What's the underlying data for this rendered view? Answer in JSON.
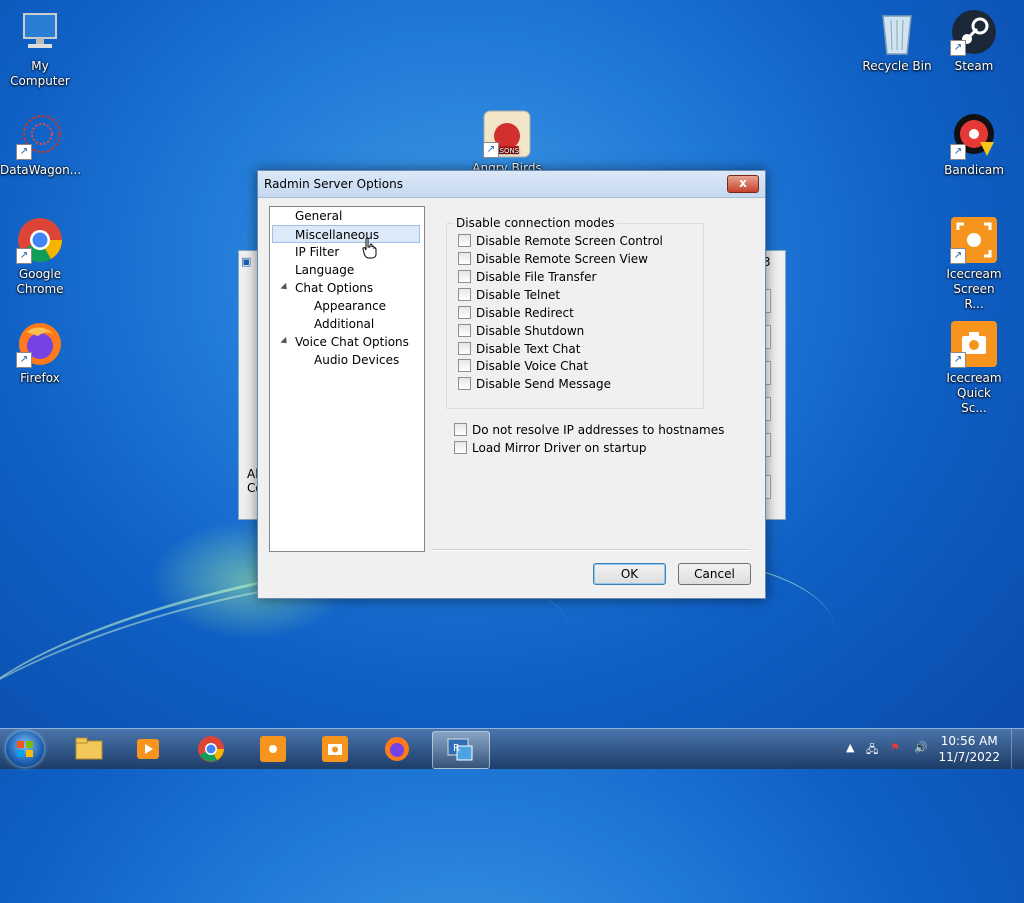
{
  "desktop_icons": {
    "my_computer": "My Computer",
    "datawagon": "DataWagon...",
    "chrome": "Google Chrome",
    "firefox": "Firefox",
    "angry_birds": "Angry Birds",
    "recycle_bin": "Recycle Bin",
    "steam": "Steam",
    "bandicam": "Bandicam",
    "icecream_rec": "Icecream Screen R...",
    "icecream_quick": "Icecream Quick Sc..."
  },
  "background_window": {
    "frag1": "All",
    "frag2": "Co",
    "frag3": "3"
  },
  "dialog": {
    "title": "Radmin Server Options",
    "close_label": "x",
    "tree": {
      "general": "General",
      "misc": "Miscellaneous",
      "ipfilter": "IP Filter",
      "language": "Language",
      "chat": "Chat Options",
      "appearance": "Appearance",
      "additional": "Additional",
      "voice": "Voice Chat Options",
      "audio": "Audio Devices"
    },
    "group_title": "Disable connection modes",
    "checkboxes": [
      "Disable Remote Screen Control",
      "Disable Remote Screen View",
      "Disable File Transfer",
      "Disable Telnet",
      "Disable Redirect",
      "Disable Shutdown",
      "Disable Text Chat",
      "Disable Voice Chat",
      "Disable Send Message"
    ],
    "options": [
      "Do not resolve IP addresses to hostnames",
      "Load Mirror Driver on startup"
    ],
    "ok_label": "OK",
    "cancel_label": "Cancel"
  },
  "taskbar": {
    "time": "10:56 AM",
    "date": "11/7/2022"
  }
}
